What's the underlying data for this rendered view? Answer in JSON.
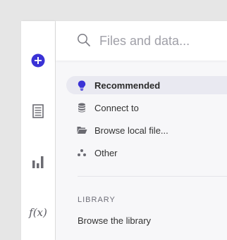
{
  "sidebar": {
    "items": [
      {
        "name": "add",
        "icon": "plus-circle-icon"
      },
      {
        "name": "table",
        "icon": "table-icon"
      },
      {
        "name": "chart",
        "icon": "bar-chart-icon"
      },
      {
        "name": "formula",
        "icon": "function-icon",
        "glyph": "f(x)"
      }
    ],
    "accent": "#3a32d6"
  },
  "search": {
    "placeholder": "Files and data..."
  },
  "menu": {
    "items": [
      {
        "label": "Recommended",
        "icon": "lightbulb-icon",
        "active": true
      },
      {
        "label": "Connect to",
        "icon": "database-icon",
        "active": false
      },
      {
        "label": "Browse local file...",
        "icon": "folder-open-icon",
        "active": false
      },
      {
        "label": "Other",
        "icon": "dots-icon",
        "active": false
      }
    ]
  },
  "library": {
    "header": "LIBRARY",
    "link": "Browse the library"
  }
}
